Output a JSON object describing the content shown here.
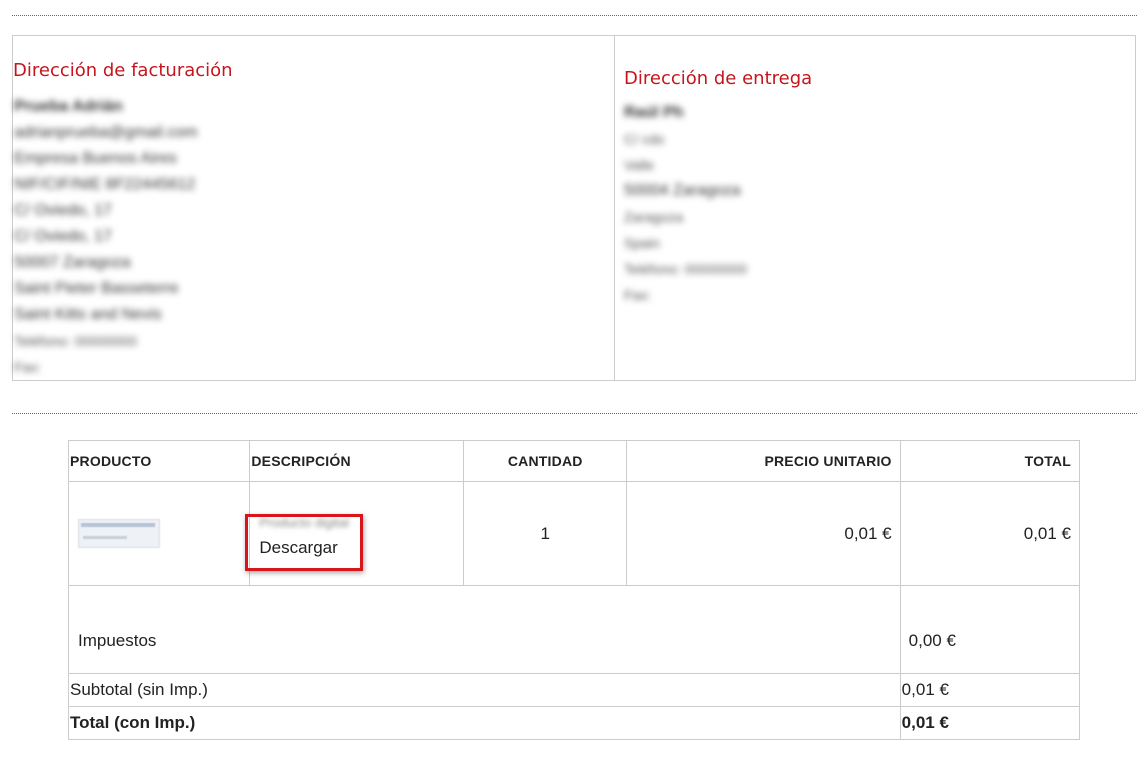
{
  "billing": {
    "heading": "Dirección de facturación",
    "lines": [
      "Prueba Adrián",
      "adrianprueba@gmail.com",
      "Empresa Buenos Aires",
      "NIF/CIF/NIE 8F22445612",
      "C/ Oviedo, 17",
      "C/ Oviedo, 17",
      "50007 Zaragoza",
      "Saint Pieter Basseterre",
      "Saint Kitts and Nevis",
      "Teléfono: 00000000",
      "Fax:"
    ]
  },
  "shipping": {
    "heading": "Dirección de entrega",
    "lines": [
      "Raúl Ph",
      "C/ cdo",
      "Valle",
      "50004 Zaragoza",
      "Zaragoza",
      "Spain",
      "Teléfono: 00000000",
      "Fax:"
    ]
  },
  "table": {
    "headers": {
      "product": "PRODUCTO",
      "description": "DESCRIPCIÓN",
      "quantity": "CANTIDAD",
      "unit_price": "PRECIO UNITARIO",
      "total": "TOTAL"
    },
    "item": {
      "description_text": "Producto digital",
      "download_label": "Descargar",
      "quantity": "1",
      "unit_price": "0,01 €",
      "total": "0,01 €"
    },
    "tax": {
      "label": "Impuestos",
      "value": "0,00 €"
    },
    "subtotal": {
      "label": "Subtotal (sin Imp.)",
      "value": "0,01 €"
    },
    "grand_total": {
      "label": "Total (con Imp.)",
      "value": "0,01 €"
    }
  },
  "colors": {
    "heading": "#c4161c",
    "highlight": "#d9151c",
    "border": "#cccccc"
  }
}
